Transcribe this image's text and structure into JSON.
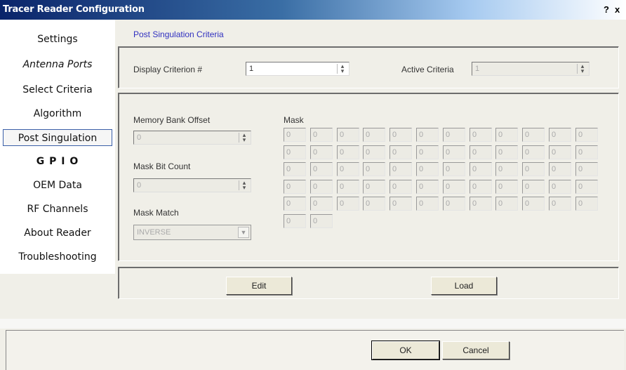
{
  "window": {
    "title": "Tracer Reader Configuration",
    "help": "?",
    "close": "x"
  },
  "sidebar": {
    "items": [
      {
        "label": "Settings",
        "style": "normal"
      },
      {
        "label": "Antenna Ports",
        "style": "italic"
      },
      {
        "label": "Select Criteria",
        "style": "normal"
      },
      {
        "label": "Algorithm",
        "style": "normal"
      },
      {
        "label": "Post Singulation",
        "style": "selected"
      },
      {
        "label": "G P I O",
        "style": "bold"
      },
      {
        "label": "OEM Data",
        "style": "normal"
      },
      {
        "label": "RF Channels",
        "style": "normal"
      },
      {
        "label": "About Reader",
        "style": "normal"
      },
      {
        "label": "Troubleshooting",
        "style": "normal"
      }
    ]
  },
  "main": {
    "heading": "Post Singulation Criteria",
    "display_criterion": {
      "label": "Display Criterion #",
      "value": "1"
    },
    "active_criteria": {
      "label": "Active Criteria",
      "value": "1"
    },
    "memory_bank_offset": {
      "label": "Memory Bank Offset",
      "value": "0"
    },
    "mask_bit_count": {
      "label": "Mask Bit Count",
      "value": "0"
    },
    "mask_match": {
      "label": "Mask Match",
      "value": "INVERSE"
    },
    "mask": {
      "label": "Mask",
      "cell_value": "0",
      "rows": 5,
      "cols": 12,
      "extra_cells": 2
    },
    "edit_label": "Edit",
    "load_label": "Load"
  },
  "footer": {
    "ok_label": "OK",
    "cancel_label": "Cancel"
  },
  "colors": {
    "title_bar": "#0a246a",
    "heading": "#3030c0",
    "selection_border": "#3a5fa8"
  }
}
